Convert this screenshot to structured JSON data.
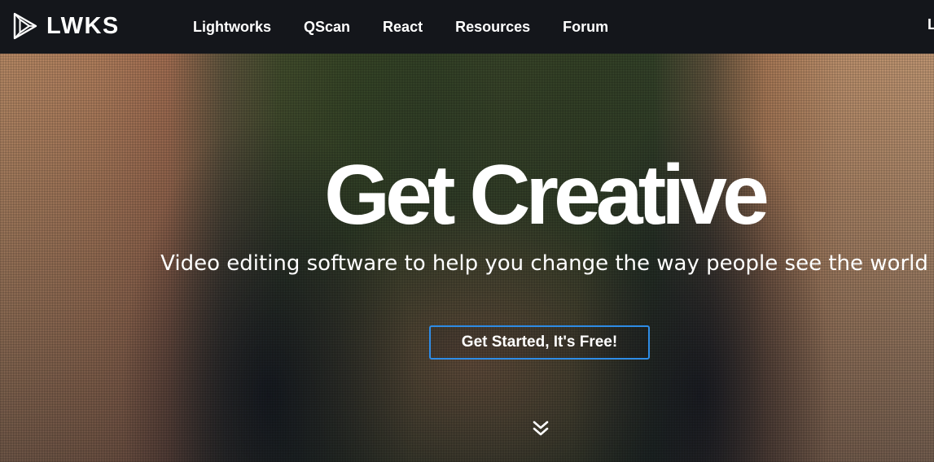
{
  "header": {
    "logo_text": "LWKS",
    "logo_icon": "play-triangle-logo-icon",
    "nav": [
      {
        "label": "Lightworks"
      },
      {
        "label": "QScan"
      },
      {
        "label": "React"
      },
      {
        "label": "Resources"
      },
      {
        "label": "Forum"
      }
    ],
    "nav_cutoff_label": "L"
  },
  "hero": {
    "title": "Get Creative",
    "subtitle": "Video editing software to help you change the way people see the world",
    "cta_label": "Get Started, It's Free!",
    "scroll_icon": "double-chevron-down-icon"
  },
  "colors": {
    "navbar_bg": "#14161b",
    "cta_border": "#2e8ce6",
    "text": "#ffffff"
  }
}
